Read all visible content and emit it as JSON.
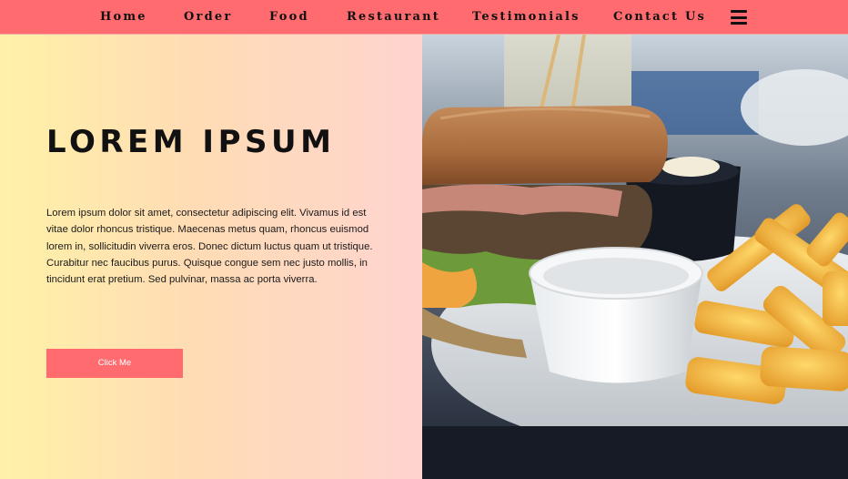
{
  "nav": {
    "items": [
      {
        "label": "Home"
      },
      {
        "label": "Order"
      },
      {
        "label": "Food"
      },
      {
        "label": "Restaurant"
      },
      {
        "label": "Testimonials"
      },
      {
        "label": "Contact Us"
      }
    ],
    "menu_icon": "hamburger-menu-icon",
    "background_color": "#ff6b6f"
  },
  "hero": {
    "title": "LOREM IPSUM",
    "body": "Lorem ipsum dolor sit amet, consectetur adipiscing elit. Vivamus id est vitae dolor rhoncus tristique. Maecenas metus quam, rhoncus euismod lorem in, sollicitudin viverra eros. Donec dictum luctus quam ut tristique. Curabitur nec faucibus purus. Quisque congue sem nec justo mollis, in tincidunt erat pretium. Sed pulvinar, massa ac porta viverra.",
    "button_label": "Click Me",
    "button_color": "#ff6b6f",
    "gradient_colors": [
      "#fff2a8",
      "#ffd4cf"
    ]
  },
  "photo": {
    "subject": "burger-with-fries-photo"
  }
}
